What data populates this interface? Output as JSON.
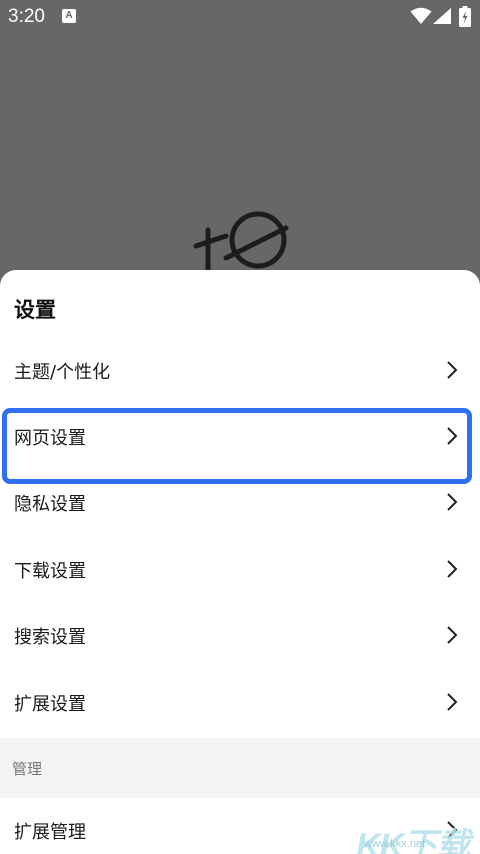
{
  "status_bar": {
    "time": "3:20",
    "notification_icon": "A"
  },
  "sheet": {
    "title": "设置",
    "items": [
      {
        "label": "主题/个性化",
        "icon": "chevron-right-icon"
      },
      {
        "label": "网页设置",
        "icon": "chevron-right-icon",
        "highlighted": true
      },
      {
        "label": "隐私设置",
        "icon": "chevron-right-icon"
      },
      {
        "label": "下载设置",
        "icon": "chevron-right-icon"
      },
      {
        "label": "搜索设置",
        "icon": "chevron-right-icon"
      },
      {
        "label": "扩展设置",
        "icon": "chevron-right-icon"
      }
    ],
    "section_label": "管理",
    "management_items": [
      {
        "label": "扩展管理",
        "icon": "chevron-right-icon"
      }
    ]
  },
  "watermark": {
    "brand": "KK下载",
    "url": "www.kkx.net"
  },
  "colors": {
    "highlight": "#2f6ff0",
    "backdrop": "#676767",
    "sheet": "#ffffff"
  }
}
